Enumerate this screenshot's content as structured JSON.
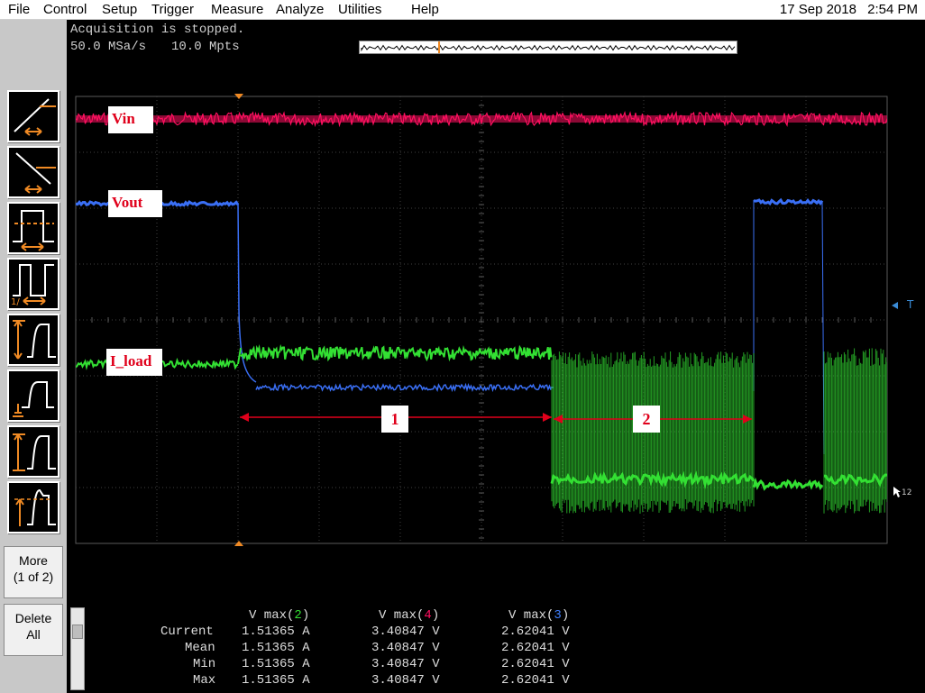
{
  "menu": {
    "file": "File",
    "control": "Control",
    "setup": "Setup",
    "trigger": "Trigger",
    "measure": "Measure",
    "analyze": "Analyze",
    "utilities": "Utilities",
    "help": "Help"
  },
  "datetime": {
    "date": "17 Sep 2018",
    "time": "2:54 PM"
  },
  "status": {
    "acquisition": "Acquisition is stopped.",
    "sample_rate": "50.0 MSa/s",
    "memory_depth": "10.0 Mpts"
  },
  "softkeys": {
    "more_label_1": "More",
    "more_label_2": "(1 of 2)",
    "delete_label_1": "Delete",
    "delete_label_2": "All"
  },
  "traces": {
    "vin": "Vin",
    "vout": "Vout",
    "i_load": "I_load"
  },
  "segments": {
    "seg1": "1",
    "seg2": "2"
  },
  "markers": {
    "trigger_level": "T",
    "channel_marker": "12"
  },
  "colors": {
    "vin": "#ff1060",
    "vout": "#3a6ff5",
    "i_load": "#33e033",
    "annotation": "#e0001b",
    "grid": "#404040"
  },
  "measurements": {
    "headers": [
      {
        "func": "V max",
        "ch": "2"
      },
      {
        "func": "V max",
        "ch": "4"
      },
      {
        "func": "V max",
        "ch": "3"
      }
    ],
    "rows": [
      {
        "label": "Current",
        "values": [
          "1.51365 A",
          "3.40847 V",
          "2.62041 V"
        ]
      },
      {
        "label": "Mean",
        "values": [
          "1.51365 A",
          "3.40847 V",
          "2.62041 V"
        ]
      },
      {
        "label": "Min",
        "values": [
          "1.51365 A",
          "3.40847 V",
          "2.62041 V"
        ]
      },
      {
        "label": "Max",
        "values": [
          "1.51365 A",
          "3.40847 V",
          "2.62041 V"
        ]
      }
    ]
  }
}
